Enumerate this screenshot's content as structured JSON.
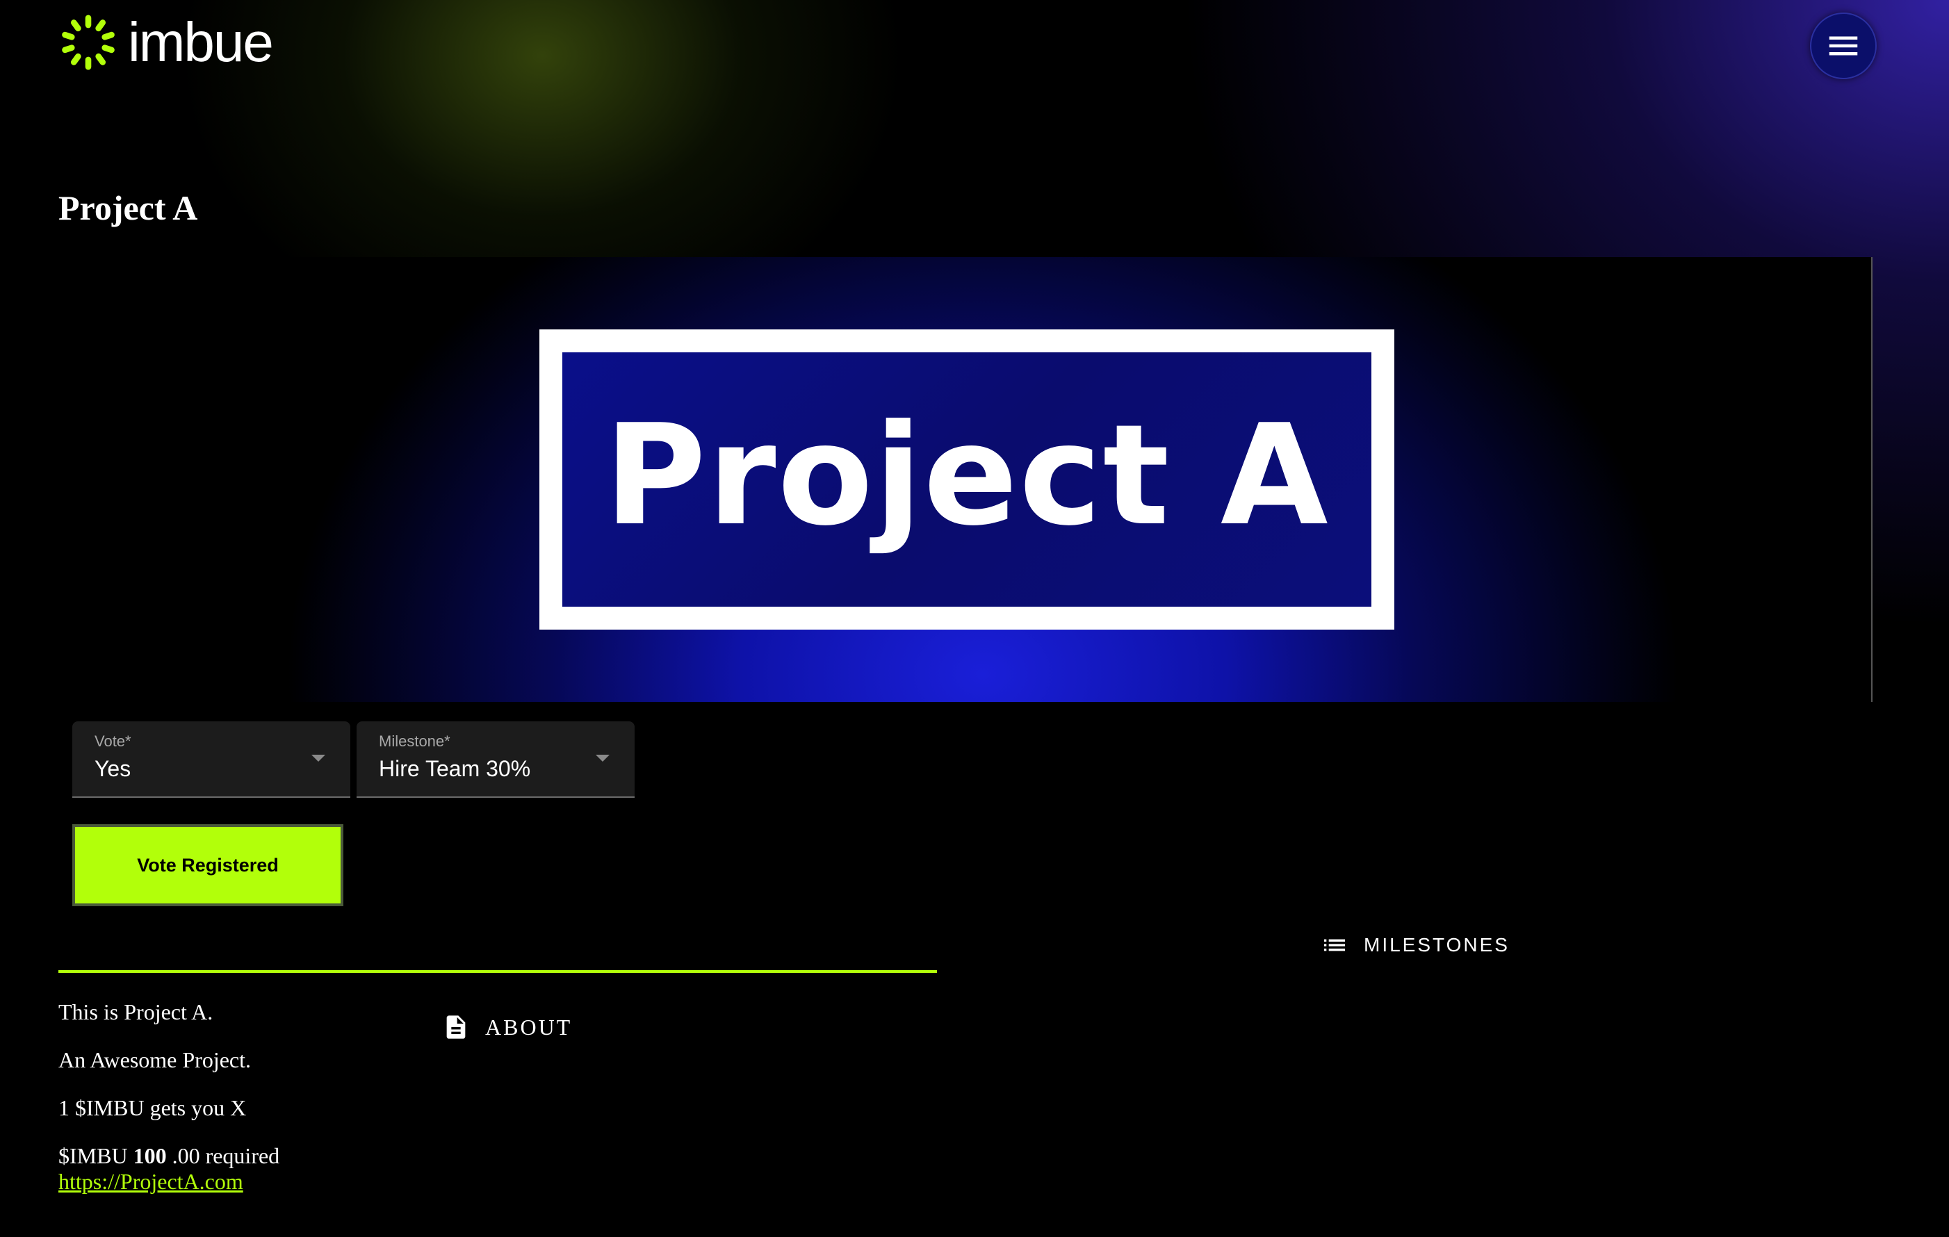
{
  "header": {
    "logo_text": "imbue",
    "logo_icon": "imbue-sunburst-icon",
    "menu_icon": "hamburger-menu-icon"
  },
  "project": {
    "title": "Project A",
    "banner_text": "Project A"
  },
  "vote_form": {
    "vote_label": "Vote*",
    "vote_value": "Yes",
    "milestone_label": "Milestone*",
    "milestone_value": "Hire Team 30%",
    "submit_label": "Vote Registered"
  },
  "tabs": [
    {
      "label": "ABOUT",
      "icon": "document-icon",
      "active": true
    },
    {
      "label": "MILESTONES",
      "icon": "list-icon",
      "active": false
    }
  ],
  "about": {
    "line1": "This is Project A.",
    "line2": "An Awesome Project.",
    "line3": "1 $IMBU gets you X",
    "required_prefix": "$IMBU",
    "required_amount": "100",
    "required_suffix": ".00 required",
    "link": "https://ProjectA.com"
  },
  "colors": {
    "accent": "#b2ff0a",
    "background": "#000000",
    "banner_blue": "#0e12a8",
    "menu_button": "#0b0f6a"
  }
}
